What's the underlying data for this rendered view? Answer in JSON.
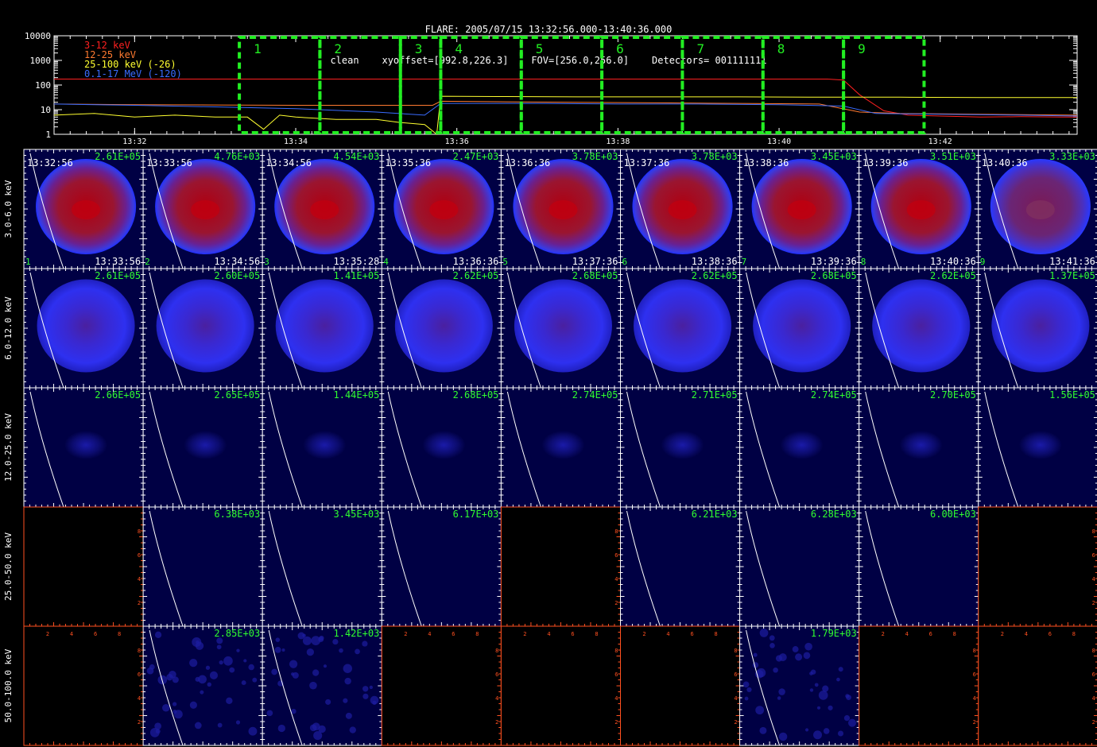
{
  "title": {
    "line1": "FLARE: 2005/07/15 13:32:56.000-13:40:36.000",
    "line2": "clean    xyoffset=[992.8,226.3]    FOV=[256.0,256.0]    Detectors= 001111111"
  },
  "chart_data": [
    {
      "type": "line",
      "name": "lightcurve",
      "yscale": "log",
      "ylim": [
        1,
        10000
      ],
      "y_ticks": [
        "1",
        "10",
        "100",
        "1000",
        "10000"
      ],
      "x_ticks": [
        "13:32",
        "13:34",
        "13:36",
        "13:38",
        "13:40",
        "13:42"
      ],
      "x_tick_minutes": [
        32,
        34,
        36,
        38,
        40,
        42
      ],
      "xlim_minutes": [
        31.0,
        43.7
      ],
      "series": [
        {
          "name": "3-12 keV",
          "color": "#ff2020",
          "x": [
            31.0,
            36.0,
            39.5,
            40.6,
            40.8,
            41.0,
            41.3,
            41.6,
            42.0,
            42.5,
            43.0,
            43.5,
            43.7
          ],
          "y": [
            175,
            175,
            175,
            175,
            160,
            40,
            9,
            6,
            5.5,
            5,
            5.2,
            5,
            5
          ]
        },
        {
          "name": "12-25 keV",
          "color": "#ff7a30",
          "x": [
            31.0,
            32.0,
            33.0,
            34.0,
            35.0,
            35.7,
            35.8,
            36.5,
            37.5,
            38.5,
            39.5,
            40.5,
            41.0,
            41.5,
            42.5,
            43.7
          ],
          "y": [
            17,
            16,
            15.5,
            15,
            15,
            15,
            22,
            21,
            20,
            19,
            18,
            17,
            8,
            7,
            6.5,
            6
          ]
        },
        {
          "name": "25-100 keV (-26)",
          "color": "#ffff30",
          "x": [
            31.0,
            31.5,
            32.0,
            32.5,
            33.0,
            33.4,
            33.6,
            33.8,
            34.0,
            34.5,
            35.0,
            35.3,
            35.6,
            35.75,
            35.8,
            36.5,
            37.5,
            38.5,
            39.5,
            40.5,
            41.5,
            42.5,
            43.7
          ],
          "y": [
            6,
            7,
            5,
            6,
            5,
            5,
            1.6,
            6,
            5,
            4,
            4,
            3,
            2.5,
            1,
            35,
            34,
            33,
            33,
            33,
            32,
            32,
            31,
            31
          ]
        },
        {
          "name": "0.1-17 MeV (-120)",
          "color": "#3a6cff",
          "x": [
            31.0,
            32.0,
            33.0,
            34.0,
            35.0,
            35.6,
            35.8,
            37.0,
            38.0,
            39.0,
            40.0,
            40.8,
            41.2,
            42.0,
            43.0,
            43.7
          ],
          "y": [
            17,
            15,
            13,
            11,
            8,
            6,
            18,
            18,
            17,
            17,
            16,
            14,
            7,
            6.5,
            6,
            5.5
          ]
        }
      ],
      "intervals": [
        {
          "label": "1",
          "start": 33.3,
          "end": 34.3
        },
        {
          "label": "2",
          "start": 34.3,
          "end": 35.3
        },
        {
          "label": "3",
          "start": 35.3,
          "end": 35.8
        },
        {
          "label": "4",
          "start": 35.8,
          "end": 36.8
        },
        {
          "label": "5",
          "start": 36.8,
          "end": 37.8
        },
        {
          "label": "6",
          "start": 37.8,
          "end": 38.8
        },
        {
          "label": "7",
          "start": 38.8,
          "end": 39.8
        },
        {
          "label": "8",
          "start": 39.8,
          "end": 40.8
        },
        {
          "label": "9",
          "start": 40.8,
          "end": 41.8
        }
      ]
    },
    {
      "type": "heatmap",
      "name": "image-grid",
      "bands": [
        "3.0-6.0 keV",
        "6.0-12.0 keV",
        "12.0-25.0 keV",
        "25.0-50.0 keV",
        "50.0-100.0 keV"
      ],
      "start_times": [
        "13:32:56",
        "13:33:56",
        "13:34:56",
        "13:35:36",
        "13:36:36",
        "13:37:36",
        "13:38:36",
        "13:39:36",
        "13:40:36"
      ],
      "end_times": [
        "13:33:56",
        "13:34:56",
        "13:35:28",
        "13:36:36",
        "13:37:36",
        "13:38:36",
        "13:39:36",
        "13:40:36",
        "13:41:36"
      ],
      "interval_labels": [
        "1",
        "2",
        "3",
        "4",
        "5",
        "6",
        "7",
        "8",
        "9"
      ],
      "peak_values": [
        [
          "2.61E+05",
          "4.76E+03",
          "4.54E+03",
          "2.47E+03",
          "3.78E+03",
          "3.78E+03",
          "3.45E+03",
          "3.51E+03",
          "3.33E+03"
        ],
        [
          "2.61E+05",
          "2.60E+05",
          "1.41E+05",
          "2.62E+05",
          "2.68E+05",
          "2.62E+05",
          "2.68E+05",
          "2.62E+05",
          "1.37E+05"
        ],
        [
          "2.66E+05",
          "2.65E+05",
          "1.44E+05",
          "2.68E+05",
          "2.74E+05",
          "2.71E+05",
          "2.74E+05",
          "2.70E+05",
          "1.56E+05"
        ],
        [
          "",
          "6.38E+03",
          "3.45E+03",
          "6.17E+03",
          "",
          "6.21E+03",
          "6.28E+03",
          "6.00E+03",
          ""
        ],
        [
          "",
          "2.85E+03",
          "1.42E+03",
          "",
          "",
          "",
          "1.79E+03",
          "",
          ""
        ]
      ],
      "cell_kind": [
        [
          "red",
          "red",
          "red",
          "red",
          "red",
          "red",
          "red",
          "red",
          "dimred"
        ],
        [
          "blue",
          "blue",
          "blue",
          "blue",
          "blue",
          "blue",
          "blue",
          "blue",
          "blue"
        ],
        [
          "faint",
          "faint",
          "faint",
          "faint",
          "faint",
          "faint",
          "faint",
          "faint",
          "faint"
        ],
        [
          "empty",
          "dark",
          "dark",
          "dark",
          "empty",
          "dark",
          "dark",
          "dark",
          "empty"
        ],
        [
          "empty",
          "noise",
          "noise",
          "empty",
          "empty",
          "empty",
          "noise",
          "empty",
          "empty"
        ]
      ],
      "empty_axis_ticks": [
        "2",
        "4",
        "6",
        "8"
      ],
      "colors": {
        "time_label": "#ffffff",
        "value_label": "#30ff30",
        "interval_box": "#22ee22",
        "cell_bg": "#000044",
        "empty_axis": "#ff5020"
      }
    }
  ]
}
